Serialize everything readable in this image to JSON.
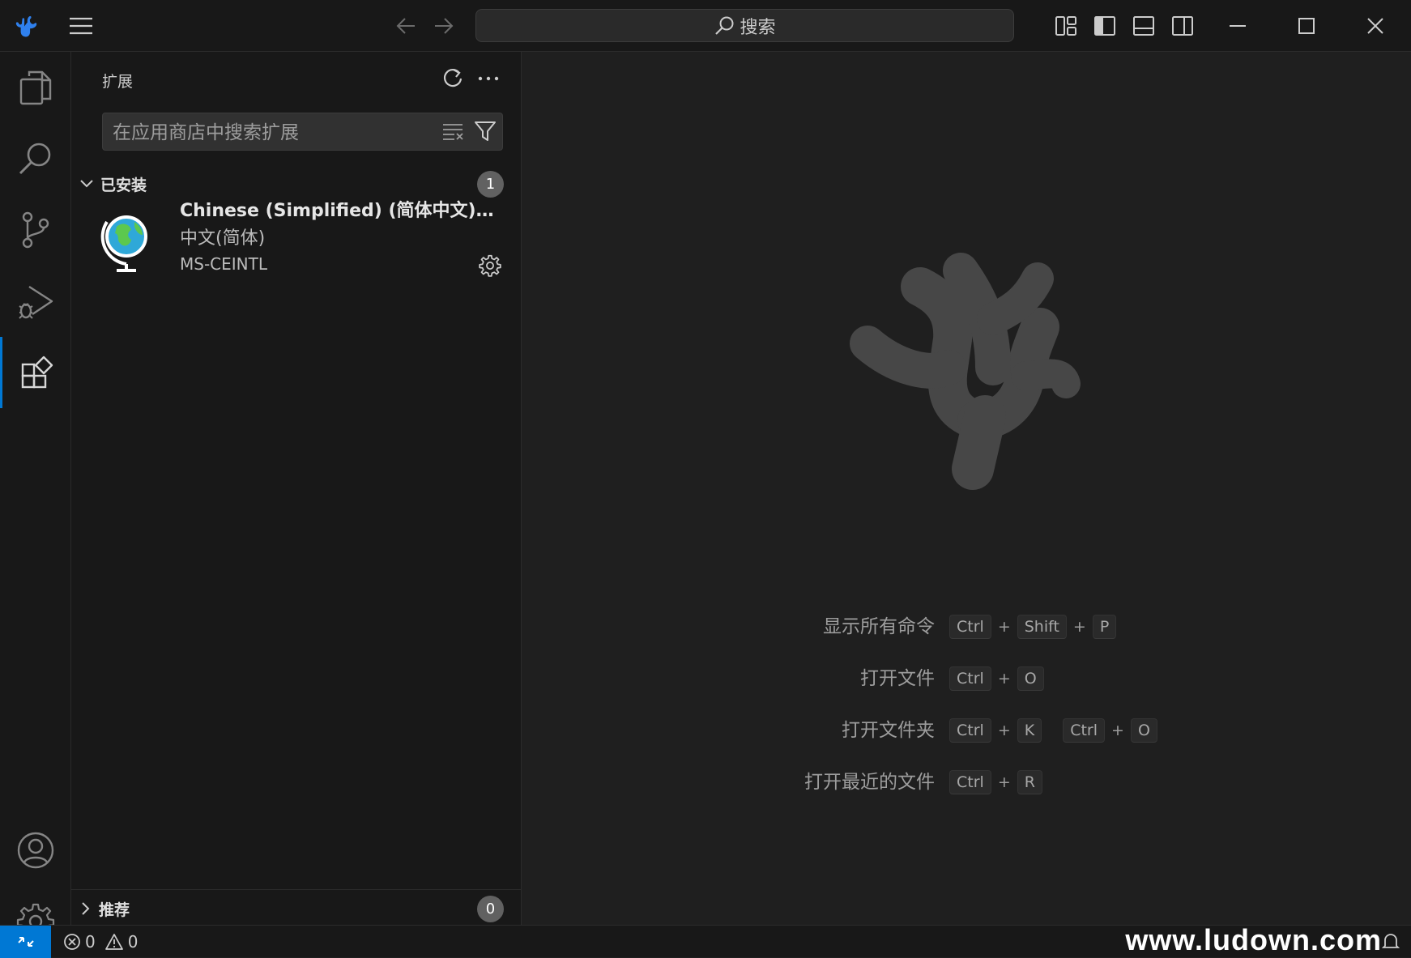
{
  "titlebar": {
    "search_label": "搜索",
    "icons": [
      "app-logo-icon",
      "menu-icon",
      "back-arrow-icon",
      "forward-arrow-icon",
      "customize-layout-icon",
      "toggle-primary-sidebar-icon",
      "toggle-panel-icon",
      "toggle-secondary-sidebar-icon",
      "minimize-icon",
      "maximize-icon",
      "close-icon"
    ]
  },
  "activity_bar": {
    "items": [
      "explorer-icon",
      "search-icon",
      "source-control-icon",
      "run-debug-icon",
      "extensions-icon"
    ],
    "bottom_items": [
      "accounts-icon",
      "manage-gear-icon"
    ],
    "active": "extensions-icon"
  },
  "sidebar": {
    "title": "扩展",
    "search_placeholder": "在应用商店中搜索扩展",
    "installed": {
      "label": "已安装",
      "count": "1",
      "items": [
        {
          "name": "Chinese (Simplified) (简体中文) Language Pack for Visual Studio Code",
          "description": "中文(简体)",
          "publisher": "MS-CEINTL"
        }
      ]
    },
    "recommended": {
      "label": "推荐",
      "count": "0"
    }
  },
  "editor": {
    "watermark_logo": "vscodium-logo-icon",
    "shortcuts": [
      {
        "label": "显示所有命令",
        "keys": [
          [
            "Ctrl",
            "Shift",
            "P"
          ]
        ]
      },
      {
        "label": "打开文件",
        "keys": [
          [
            "Ctrl",
            "O"
          ]
        ]
      },
      {
        "label": "打开文件夹",
        "keys": [
          [
            "Ctrl",
            "K"
          ],
          [
            "Ctrl",
            "O"
          ]
        ]
      },
      {
        "label": "打开最近的文件",
        "keys": [
          [
            "Ctrl",
            "R"
          ]
        ]
      }
    ]
  },
  "statusbar": {
    "errors": "0",
    "warnings": "0"
  },
  "watermark_text": "www.ludown.com",
  "colors": {
    "accent": "#0078d4",
    "logo_gray": "#474747",
    "app_logo_blue": "#2f80ed"
  }
}
